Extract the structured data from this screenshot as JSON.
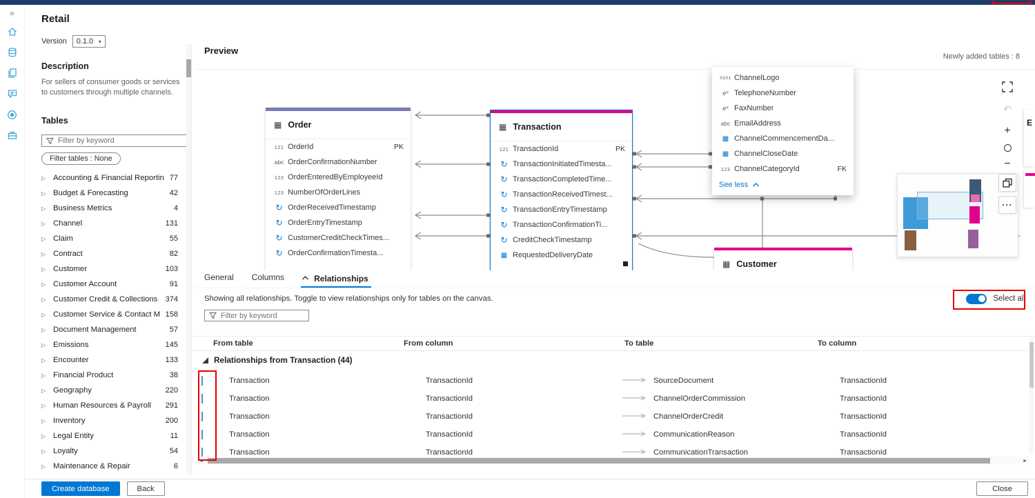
{
  "colors": {
    "accent": "#0078d4",
    "pink": "#e3008c",
    "purple": "#7a79ba",
    "red": "#e50000",
    "rail-blue": "#41a8da"
  },
  "icon_glyphs": {
    "int": "121",
    "text": "abc",
    "num": "123",
    "time": "↻",
    "date": "▦",
    "bin": "0101",
    "fx": "eˣ",
    "grid": "▦"
  },
  "sidebar": {
    "title": "Retail",
    "version_label": "Version",
    "version_value": "0.1.0",
    "description_title": "Description",
    "description_text": "For sellers of consumer goods or services to customers through multiple channels.",
    "tables_title": "Tables",
    "filter_placeholder": "Filter by keyword",
    "filter_pill": "Filter tables : None",
    "categories": [
      {
        "label": "Accounting & Financial Reporting",
        "count": "77"
      },
      {
        "label": "Budget & Forecasting",
        "count": "42"
      },
      {
        "label": "Business Metrics",
        "count": "4"
      },
      {
        "label": "Channel",
        "count": "131"
      },
      {
        "label": "Claim",
        "count": "55"
      },
      {
        "label": "Contract",
        "count": "82"
      },
      {
        "label": "Customer",
        "count": "103"
      },
      {
        "label": "Customer Account",
        "count": "91"
      },
      {
        "label": "Customer Credit & Collections",
        "count": "374"
      },
      {
        "label": "Customer Service & Contact Man...",
        "count": "158"
      },
      {
        "label": "Document Management",
        "count": "57"
      },
      {
        "label": "Emissions",
        "count": "145"
      },
      {
        "label": "Encounter",
        "count": "133"
      },
      {
        "label": "Financial Product",
        "count": "38"
      },
      {
        "label": "Geography",
        "count": "220"
      },
      {
        "label": "Human Resources & Payroll",
        "count": "291"
      },
      {
        "label": "Inventory",
        "count": "200"
      },
      {
        "label": "Legal Entity",
        "count": "11"
      },
      {
        "label": "Loyalty",
        "count": "54"
      },
      {
        "label": "Maintenance & Repair",
        "count": "6"
      }
    ]
  },
  "preview": {
    "title": "Preview",
    "newly_added": "Newly added tables : 8",
    "order": {
      "title": "Order",
      "columns": [
        {
          "icon": "int",
          "name": "OrderId",
          "key": "PK"
        },
        {
          "icon": "text",
          "name": "OrderConfirmationNumber"
        },
        {
          "icon": "num",
          "name": "OrderEnteredByEmployeeId"
        },
        {
          "icon": "num",
          "name": "NumberOfOrderLines"
        },
        {
          "icon": "time",
          "name": "OrderReceivedTimestamp"
        },
        {
          "icon": "time",
          "name": "OrderEntryTimestamp"
        },
        {
          "icon": "time",
          "name": "CustomerCreditCheckTimes..."
        },
        {
          "icon": "time",
          "name": "OrderConfirmationTimesta..."
        }
      ]
    },
    "transaction": {
      "title": "Transaction",
      "columns": [
        {
          "icon": "int",
          "name": "TransactionId",
          "key": "PK"
        },
        {
          "icon": "time",
          "name": "TransactionInitiatedTimesta..."
        },
        {
          "icon": "time",
          "name": "TransactionCompletedTime..."
        },
        {
          "icon": "time",
          "name": "TransactionReceivedTimest..."
        },
        {
          "icon": "time",
          "name": "TransactionEntryTimestamp"
        },
        {
          "icon": "time",
          "name": "TransactionConfirmationTi..."
        },
        {
          "icon": "time",
          "name": "CreditCheckTimestamp"
        },
        {
          "icon": "date",
          "name": "RequestedDeliveryDate"
        }
      ]
    },
    "channel_popup": {
      "columns": [
        {
          "icon": "bin",
          "name": "ChannelLogo"
        },
        {
          "icon": "fx",
          "name": "TelephoneNumber"
        },
        {
          "icon": "fx",
          "name": "FaxNumber"
        },
        {
          "icon": "text",
          "name": "EmailAddress"
        },
        {
          "icon": "date",
          "name": "ChannelCommencementDa..."
        },
        {
          "icon": "date",
          "name": "ChannelCloseDate"
        },
        {
          "icon": "num",
          "name": "ChannelCategoryId",
          "key": "FK"
        }
      ],
      "see_less": "See less"
    },
    "customer": {
      "title": "Customer"
    },
    "edge_fragment": "E"
  },
  "details": {
    "tabs": {
      "general": "General",
      "columns": "Columns",
      "relationships": "Relationships"
    },
    "info_text": "Showing all relationships. Toggle to view relationships only for tables on the canvas.",
    "select_all_label": "Select all",
    "filter_placeholder": "Filter by keyword",
    "headers": {
      "from_table": "From table",
      "from_column": "From column",
      "to_table": "To table",
      "to_column": "To column"
    },
    "group_label": "Relationships from Transaction (44)",
    "rows": [
      {
        "from_table": "Transaction",
        "from_column": "TransactionId",
        "to_table": "SourceDocument",
        "to_column": "TransactionId"
      },
      {
        "from_table": "Transaction",
        "from_column": "TransactionId",
        "to_table": "ChannelOrderCommission",
        "to_column": "TransactionId"
      },
      {
        "from_table": "Transaction",
        "from_column": "TransactionId",
        "to_table": "ChannelOrderCredit",
        "to_column": "TransactionId"
      },
      {
        "from_table": "Transaction",
        "from_column": "TransactionId",
        "to_table": "CommunicationReason",
        "to_column": "TransactionId"
      },
      {
        "from_table": "Transaction",
        "from_column": "TransactionId",
        "to_table": "CommunicationTransaction",
        "to_column": "TransactionId"
      }
    ]
  },
  "footer": {
    "create": "Create database",
    "back": "Back",
    "close": "Close"
  }
}
